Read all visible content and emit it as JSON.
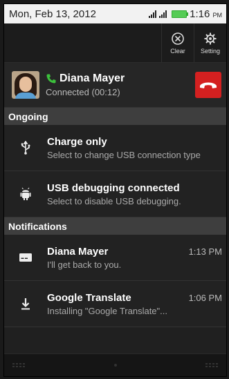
{
  "status_bar": {
    "date": "Mon, Feb 13, 2012",
    "time": "1:16",
    "ampm": "PM",
    "battery_color": "#55cc55"
  },
  "actions": {
    "clear_label": "Clear",
    "setting_label": "Setting"
  },
  "call": {
    "name": "Diana Mayer",
    "status": "Connected (00:12)",
    "hangup_color": "#d42020"
  },
  "sections": {
    "ongoing": "Ongoing",
    "notifications": "Notifications"
  },
  "ongoing": [
    {
      "icon": "usb-icon",
      "title": "Charge only",
      "subtitle": "Select to change USB connection type"
    },
    {
      "icon": "android-debug-icon",
      "title": "USB debugging connected",
      "subtitle": "Select to disable USB debugging."
    }
  ],
  "notifications": [
    {
      "icon": "message-icon",
      "title": "Diana Mayer",
      "time": "1:13 PM",
      "subtitle": "I'll get back to you."
    },
    {
      "icon": "download-icon",
      "title": "Google Translate",
      "time": "1:06 PM",
      "subtitle": "Installing \"Google Translate\"..."
    }
  ]
}
